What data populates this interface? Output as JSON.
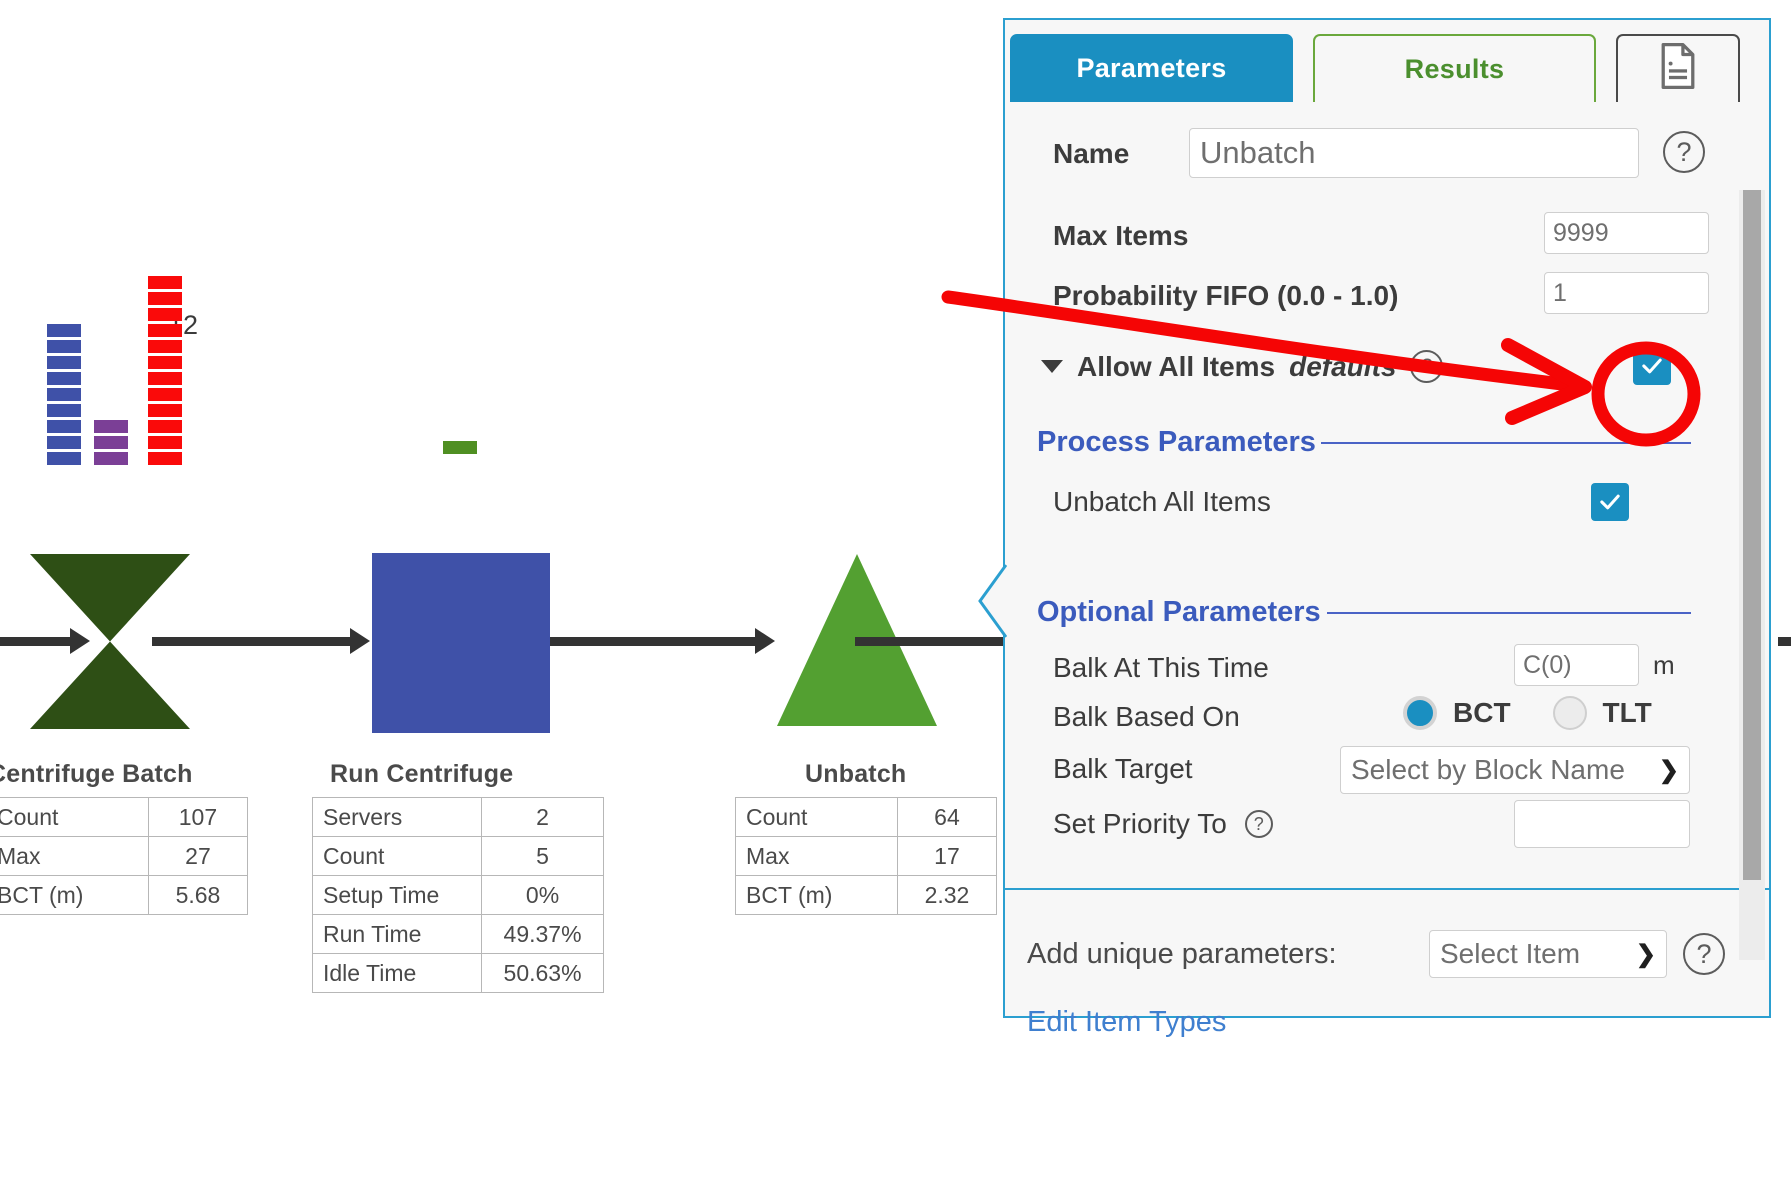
{
  "diagram": {
    "blocks": [
      {
        "name": "Centrifuge Batch",
        "shape": "hourglass",
        "stats": [
          {
            "key": "Count",
            "value": "107"
          },
          {
            "key": "Max",
            "value": "27"
          },
          {
            "key": "BCT (m)",
            "value": "5.68"
          }
        ]
      },
      {
        "name": "Run Centrifuge",
        "shape": "square",
        "stats": [
          {
            "key": "Servers",
            "value": "2"
          },
          {
            "key": "Count",
            "value": "5"
          },
          {
            "key": "Setup Time",
            "value": "0%"
          },
          {
            "key": "Run Time",
            "value": "49.37%"
          },
          {
            "key": "Idle Time",
            "value": "50.63%"
          }
        ]
      },
      {
        "name": "Unbatch",
        "shape": "triangle",
        "stats": [
          {
            "key": "Count",
            "value": "64"
          },
          {
            "key": "Max",
            "value": "17"
          },
          {
            "key": "BCT (m)",
            "value": "2.32"
          }
        ]
      }
    ],
    "queue_bars": {
      "label": "12",
      "stacks": [
        {
          "color": "#3f51a8",
          "segments": 9
        },
        {
          "color": "#7b3f96",
          "segments": 3
        },
        {
          "color": "#fa0a0a",
          "segments": 12
        }
      ],
      "server_stack": {
        "color": "#4f8f22",
        "segments": 1
      }
    }
  },
  "panel": {
    "tabs": [
      {
        "label": "Parameters",
        "state": "active"
      },
      {
        "label": "Results",
        "state": "inactive"
      },
      {
        "label": "",
        "state": "icon",
        "icon": "notes-document-icon"
      }
    ],
    "name_field": {
      "label": "Name",
      "value": "Unbatch"
    },
    "max_items": {
      "label": "Max Items",
      "value": "9999"
    },
    "prob_fifo": {
      "label": "Probability FIFO (0.0 - 1.0)",
      "value": "1"
    },
    "allow_all_items": {
      "label": "Allow All Items",
      "emphasis": "defaults",
      "checked": true
    },
    "process_parameters": {
      "heading": "Process Parameters",
      "rows": [
        {
          "label": "Unbatch All Items",
          "type": "checkbox",
          "checked": true
        }
      ]
    },
    "optional_parameters": {
      "heading": "Optional Parameters",
      "balk_at_this_time": {
        "label": "Balk At This Time",
        "value": "C(0)",
        "unit": "m"
      },
      "balk_based_on": {
        "label": "Balk Based On",
        "options": [
          "BCT",
          "TLT"
        ],
        "selected": "BCT"
      },
      "balk_target": {
        "label": "Balk Target",
        "value": "Select by Block Name"
      },
      "set_priority_to": {
        "label": "Set Priority To",
        "value": ""
      }
    },
    "footer": {
      "add_unique_label": "Add unique parameters:",
      "add_unique_value": "Select Item",
      "edit_item_types": "Edit Item Types"
    }
  },
  "annotation": {
    "color": "#f50505",
    "type": "arrow-and-circle",
    "target": "allow-all-items-checkbox"
  }
}
